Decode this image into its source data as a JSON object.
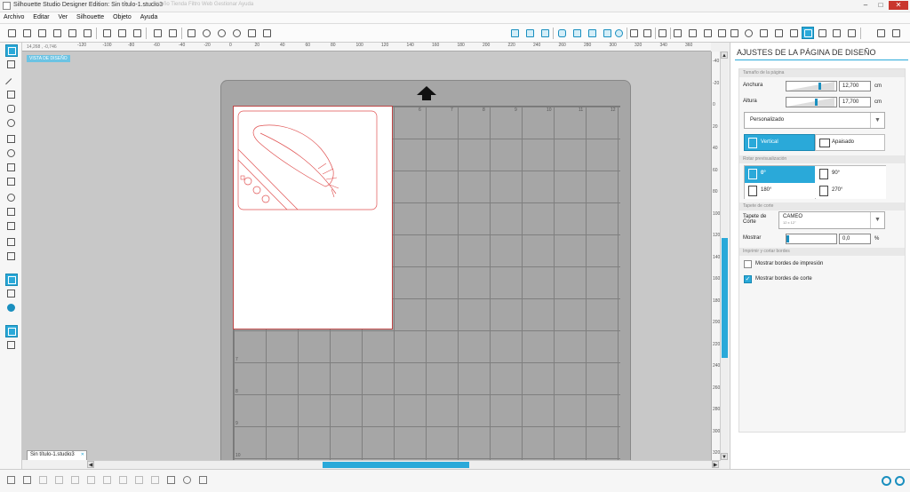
{
  "window": {
    "title": "Silhouette Studio Designer Edition: Sin título-1.studio3",
    "ghost_tabs": "Diseño   Tienda   Filtro   Web   Gestionar   Ayuda"
  },
  "menu": [
    "Archivo",
    "Editar",
    "Ver",
    "Silhouette",
    "Objeto",
    "Ayuda"
  ],
  "workspace": {
    "coord_readout": "14,268 , -0,746",
    "view_label": "VISTA DE DISEÑO",
    "ruler_h": [
      "-120",
      "-100",
      "-80",
      "-60",
      "-40",
      "-20",
      "0",
      "20",
      "40",
      "60",
      "80",
      "100",
      "120",
      "140",
      "160",
      "180",
      "200",
      "220",
      "240",
      "260",
      "280",
      "300",
      "320",
      "340",
      "360"
    ],
    "ruler_v": [
      "-40",
      "-20",
      "0",
      "20",
      "40",
      "60",
      "80",
      "100",
      "120",
      "140",
      "160",
      "180",
      "200",
      "220",
      "240",
      "260",
      "280",
      "300",
      "320"
    ],
    "grid_numbers_top": [
      "1",
      "2",
      "3",
      "4",
      "5",
      "6",
      "7",
      "8",
      "9",
      "10",
      "11",
      "12"
    ],
    "grid_numbers_left": [
      "7",
      "8",
      "9",
      "10",
      "11"
    ],
    "doc_tab": "Sin título-1.studio3"
  },
  "panel": {
    "title": "AJUSTES DE LA PÁGINA DE DISEÑO",
    "page_size_section": "Tamaño de la página",
    "width_label": "Anchura",
    "width_value": "12,700",
    "height_label": "Altura",
    "height_value": "17,700",
    "unit": "cm",
    "size_preset": "Personalizado",
    "orientation_vertical": "Vertical",
    "orientation_horizontal": "Apaisado",
    "rotate_section": "Rotar previsualización",
    "rot_0": "0°",
    "rot_90": "90°",
    "rot_180": "180°",
    "rot_270": "270°",
    "mat_section": "Tapete de corte",
    "mat_label": "Tapete de Corte",
    "mat_value": "CAMEO",
    "mat_sub": "12 x 12\"",
    "show_label": "Mostrar",
    "show_value": "0,0",
    "show_unit": "%",
    "print_section": "Imprimir y cortar bordes",
    "show_print_borders": "Mostrar bordes de impresión",
    "show_cut_borders": "Mostrar bordes de corte",
    "print_checked": false,
    "cut_checked": true
  },
  "colors": {
    "accent": "#2aa9d9",
    "cut_line": "#e05050",
    "mat": "#a6a6a6"
  }
}
